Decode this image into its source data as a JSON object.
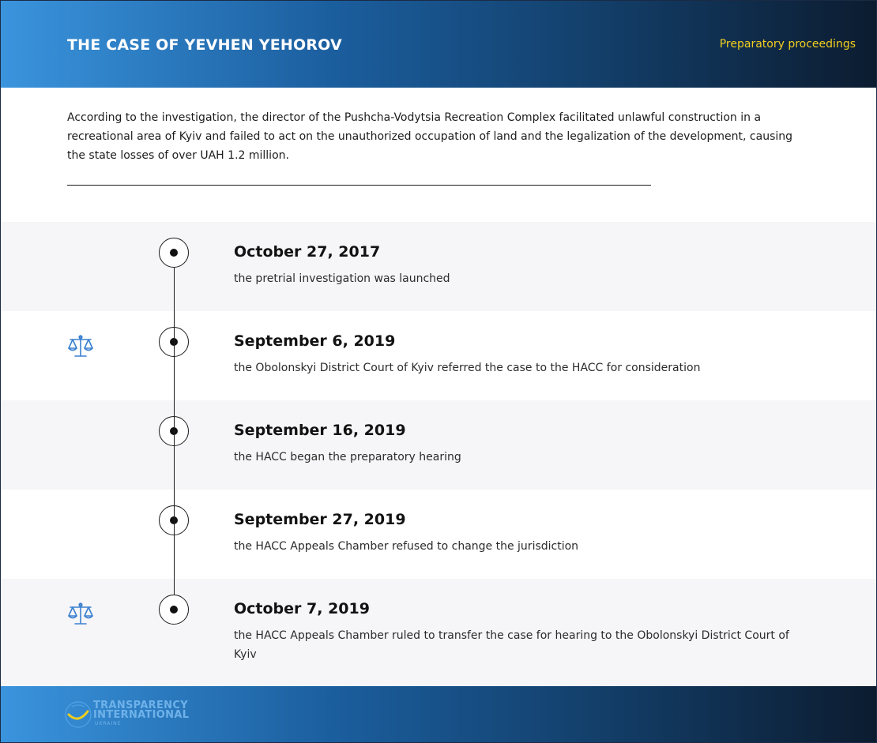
{
  "header": {
    "title": "THE CASE OF YEVHEN YEHOROV",
    "stage": "Preparatory proceedings"
  },
  "summary": "According to the investigation, the director of the Pushcha-Vodytsia Recreation Complex facilitated unlawful construction in a recreational area of Kyiv and failed to act on the unauthorized occupation of land and the legalization of the development, causing the state losses of over UAH 1.2 million.",
  "timeline": [
    {
      "date": "October 27, 2017",
      "description": "the pretrial investigation was launched",
      "icon": "none"
    },
    {
      "date": "September 6, 2019",
      "description": "the Obolonskyi District Court of Kyiv referred the case to the HACC for consideration",
      "icon": "scales-icon"
    },
    {
      "date": "September 16, 2019",
      "description": "the HACC began the preparatory hearing",
      "icon": "none"
    },
    {
      "date": "September 27, 2019",
      "description": "the HACC Appeals Chamber refused to change the jurisdiction",
      "icon": "none"
    },
    {
      "date": "October 7, 2019",
      "description": "the HACC Appeals Chamber ruled to transfer the case for hearing to the Obolonskyi District Court of Kyiv",
      "icon": "scales-icon"
    }
  ],
  "footer": {
    "logo_line1": "TRANSPARENCY",
    "logo_line2": "INTERNATIONAL",
    "logo_line3": "UKRAINE"
  },
  "colors": {
    "accent_blue": "#3a94dd",
    "stage_yellow": "#f2cf1e",
    "row_shade": "#f6f6f8",
    "dark_navy": "#0c1c30"
  }
}
